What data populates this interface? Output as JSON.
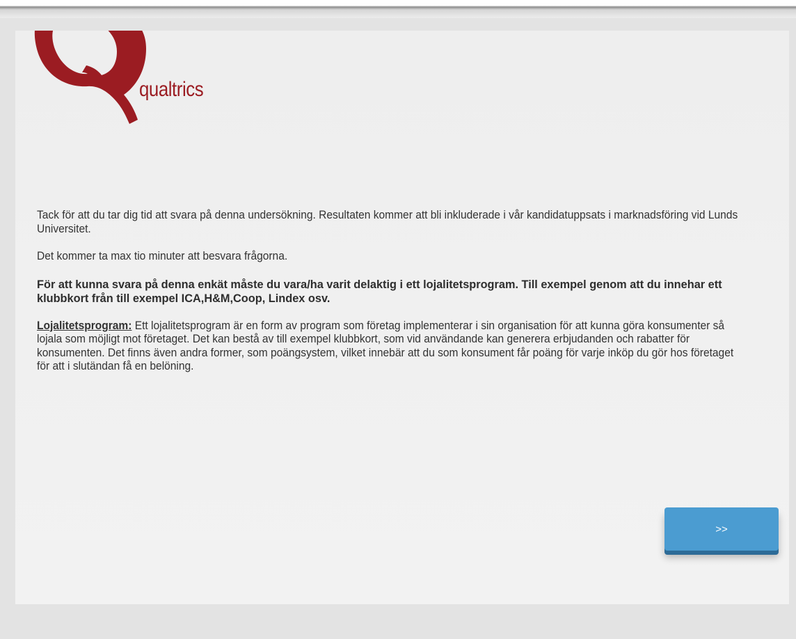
{
  "logo": {
    "wordmark": "qualtrics",
    "brand_color": "#9b1c22"
  },
  "intro": {
    "paragraph1": "Tack för att du tar dig tid att svara på denna undersökning. Resultaten kommer att bli inkluderade i vår kandidatuppsats i marknadsföring vid Lunds Universitet.",
    "paragraph2": "Det kommer ta max tio minuter att besvara frågorna.",
    "requirement": "För att kunna svara på denna enkät måste du vara/ha varit delaktig i ett lojalitetsprogram. Till exempel genom att du innehar ett klubbkort från till exempel ICA,H&M,Coop, Lindex osv.",
    "definition_term": "Lojalitetsprogram:",
    "definition_text": " Ett lojalitetsprogram är en form av program som företag implementerar i sin organisation för att kunna göra konsumenter så lojala som möjligt mot företaget. Det kan bestå av till exempel klubbkort, som vid användande kan generera erbjudanden och rabatter för konsumenten. Det finns även andra former, som poängsystem, vilket innebär att du som konsument får poäng för varje inköp du gör hos företaget för att i slutändan få en belöning."
  },
  "navigation": {
    "next_label": ">>",
    "button_color": "#4b9cd1"
  }
}
